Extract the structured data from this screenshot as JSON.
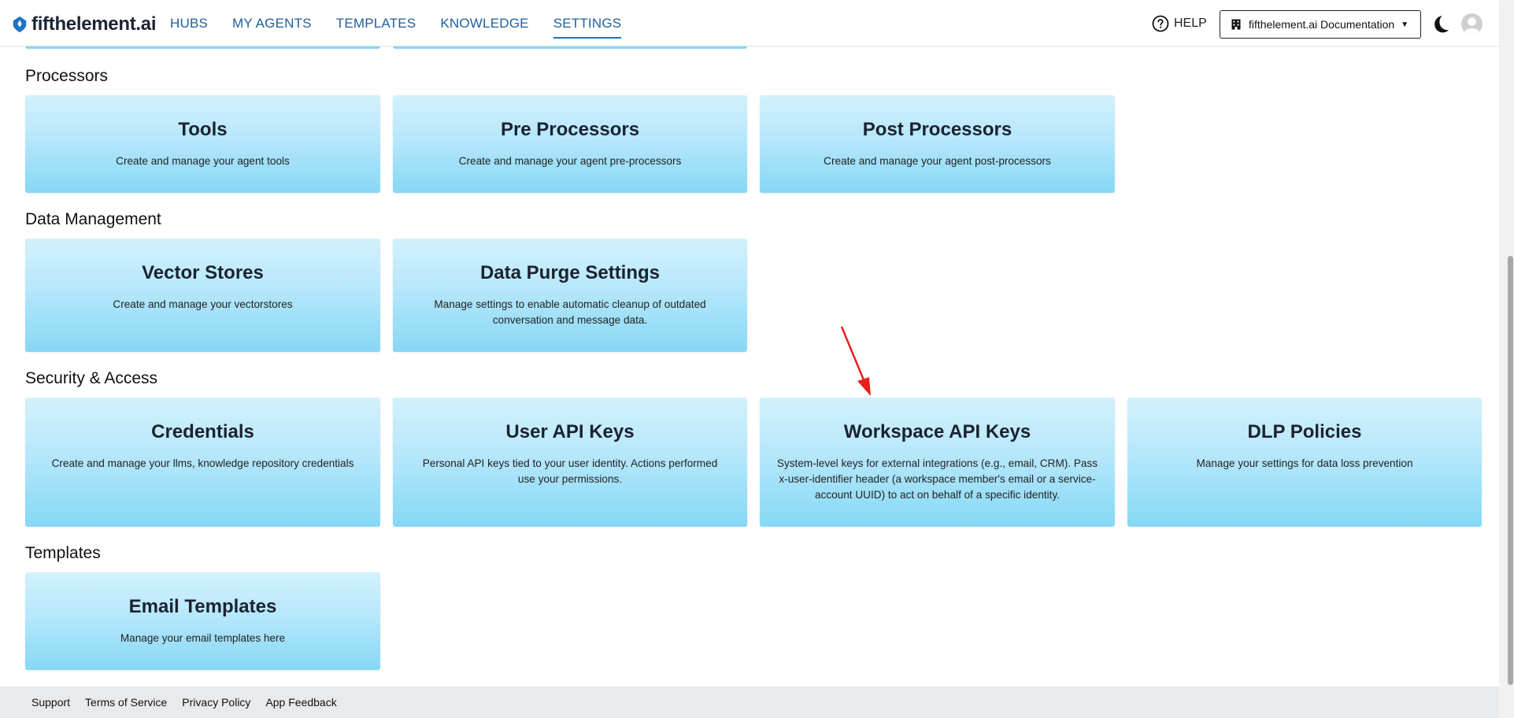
{
  "header": {
    "brand": "fifthelement.ai",
    "nav": [
      {
        "label": "HUBS"
      },
      {
        "label": "MY AGENTS"
      },
      {
        "label": "TEMPLATES"
      },
      {
        "label": "KNOWLEDGE"
      },
      {
        "label": "SETTINGS",
        "active": true
      }
    ],
    "help_label": "HELP",
    "workspace_select": "fifthelement.ai Documentation"
  },
  "sections": {
    "processors": {
      "title": "Processors",
      "cards": [
        {
          "title": "Tools",
          "desc": "Create and manage your agent tools"
        },
        {
          "title": "Pre Processors",
          "desc": "Create and manage your agent pre-processors"
        },
        {
          "title": "Post Processors",
          "desc": "Create and manage your agent post-processors"
        }
      ]
    },
    "data_management": {
      "title": "Data Management",
      "cards": [
        {
          "title": "Vector Stores",
          "desc": "Create and manage your vectorstores"
        },
        {
          "title": "Data Purge Settings",
          "desc": "Manage settings to enable automatic cleanup of outdated conversation and message data."
        }
      ]
    },
    "security": {
      "title": "Security & Access",
      "cards": [
        {
          "title": "Credentials",
          "desc": "Create and manage your llms, knowledge repository credentials"
        },
        {
          "title": "User API Keys",
          "desc": "Personal API keys tied to your user identity. Actions performed use your permissions."
        },
        {
          "title": "Workspace API Keys",
          "desc": "System-level keys for external integrations (e.g., email, CRM). Pass x-user-identifier header (a workspace member's email or a service-account UUID) to act on behalf of a specific identity."
        },
        {
          "title": "DLP Policies",
          "desc": "Manage your settings for data loss prevention"
        }
      ]
    },
    "templates": {
      "title": "Templates",
      "cards": [
        {
          "title": "Email Templates",
          "desc": "Manage your email templates here"
        }
      ]
    }
  },
  "footer": {
    "links": [
      "Support",
      "Terms of Service",
      "Privacy Policy",
      "App Feedback"
    ]
  },
  "colors": {
    "card_top": "#d3f1fd",
    "card_bottom": "#86d8f5",
    "nav_link": "#1f5f9e",
    "annotation_arrow": "#e8201c"
  },
  "icons": {
    "logo": "fifthelement-logo-icon",
    "help": "help-circle-icon",
    "workspace": "building-icon",
    "theme": "moon-icon",
    "user": "avatar-icon"
  }
}
